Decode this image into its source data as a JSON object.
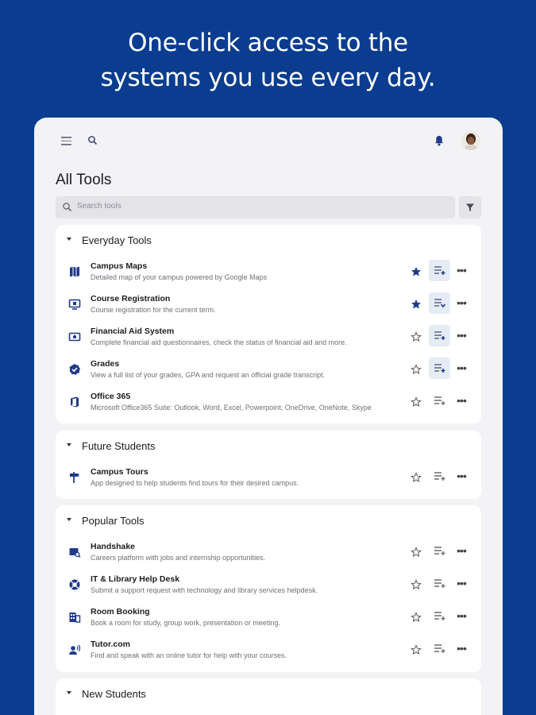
{
  "headline": {
    "line1": "One-click access to the",
    "line2": "systems you use every day."
  },
  "app": {
    "page_title": "All Tools",
    "search_placeholder": "Search tools",
    "icons": [
      "menu-icon",
      "search-icon",
      "bell-icon",
      "filter-icon"
    ],
    "accent": "#1f3a8a"
  },
  "sections": [
    {
      "title": "Everyday Tools",
      "tools": [
        {
          "name": "Campus Maps",
          "desc": "Detailed map of your campus powered by Google Maps",
          "favorited": true,
          "quick_action": true
        },
        {
          "name": "Course Registration",
          "desc": "Course registration for the current term.",
          "favorited": true,
          "quick_action": true
        },
        {
          "name": "Financial Aid System",
          "desc": "Complete financial aid questionnaires, check the status of financial aid and more.",
          "favorited": false,
          "quick_action": true
        },
        {
          "name": "Grades",
          "desc": "View a full list of your grades, GPA and request an official grade transcript.",
          "favorited": false,
          "quick_action": true
        },
        {
          "name": "Office 365",
          "desc": "Microsoft Office365 Suite: Outlook, Word, Excel, Powerpoint, OneDrive, OneNote, Skype",
          "favorited": false,
          "quick_action": false
        }
      ]
    },
    {
      "title": "Future Students",
      "tools": [
        {
          "name": "Campus Tours",
          "desc": "App designed to help students find tours for their desired campus.",
          "favorited": false,
          "quick_action": false
        }
      ]
    },
    {
      "title": "Popular Tools",
      "tools": [
        {
          "name": "Handshake",
          "desc": "Careers platform with jobs and internship opportunities.",
          "favorited": false,
          "quick_action": false
        },
        {
          "name": "IT & Library Help Desk",
          "desc": "Submit a support request with technology and library services helpdesk.",
          "favorited": false,
          "quick_action": false
        },
        {
          "name": "Room Booking",
          "desc": "Book a room for study, group work, presentation or meeting.",
          "favorited": false,
          "quick_action": false
        },
        {
          "name": "Tutor.com",
          "desc": "Find and speak with an online tutor for help with your courses.",
          "favorited": false,
          "quick_action": false
        }
      ]
    },
    {
      "title": "New Students",
      "tools": []
    }
  ]
}
